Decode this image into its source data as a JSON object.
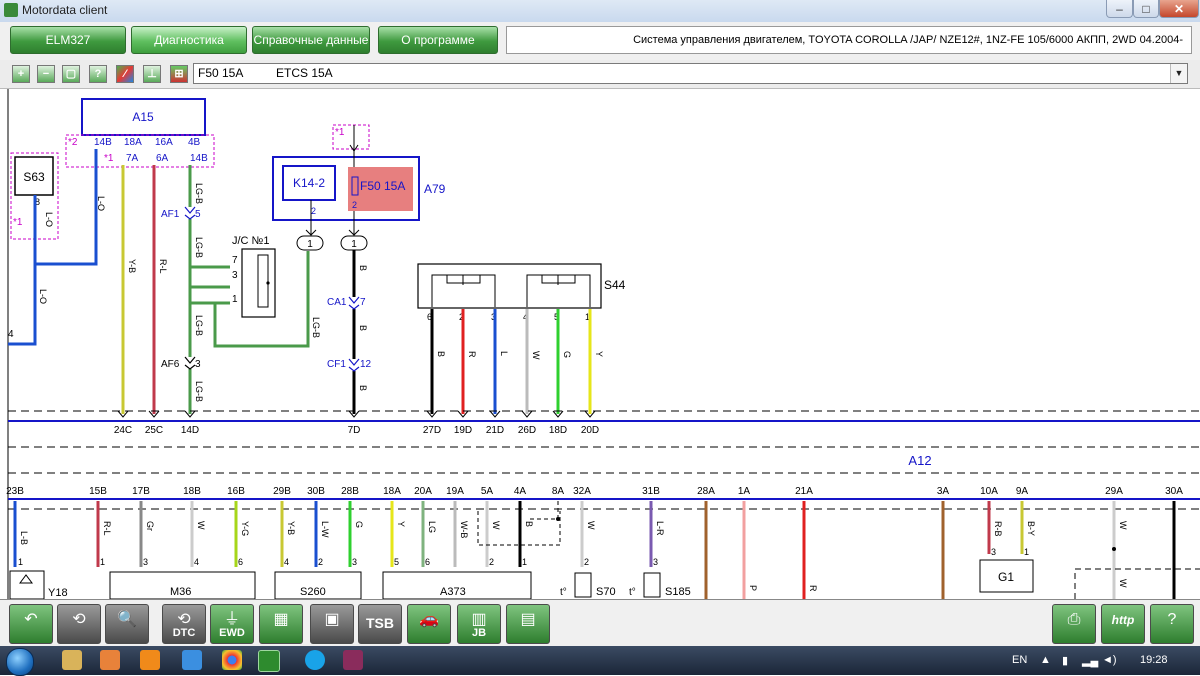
{
  "window": {
    "title": "Motordata client",
    "minimize": "‒",
    "maximize": "□",
    "close": "✕"
  },
  "menu": {
    "buttons": [
      "ELM327",
      "Диагностика",
      "Справочные данные",
      "О программе"
    ],
    "active_index": 1,
    "system_info": "Система управления двигателем, TOYOTA  COROLLA /JAP/  NZE12#,   1NZ-FE  105/6000  АКПП, 2WD  04.2004-"
  },
  "toolbar": {
    "icons": [
      "zoom-in-icon",
      "zoom-out-icon",
      "fit-icon",
      "help-icon",
      "color-icon",
      "ground-icon",
      "terminal-icon"
    ],
    "glyphs": [
      "+",
      "−",
      "▢",
      "?",
      "⁄",
      "⊥",
      "⊞"
    ],
    "selected_fuse": "F50 15A",
    "selected_fuse_desc": "ETCS 15A"
  },
  "diagram": {
    "top": {
      "A15": "A15",
      "A15_pins_top": [
        "*2",
        "14B",
        "18A",
        "16A",
        "4B"
      ],
      "A15_pins_bottom": [
        "*1",
        "7A",
        "6A",
        "14B"
      ],
      "S63": "S63",
      "star1": "*1",
      "star1b": "*1",
      "A79": "A79",
      "K14": "K14-2",
      "K14_pin": "2",
      "F50": "F50 15A",
      "F50_pin": "2",
      "jc": "J/C №1",
      "jc_pins": [
        "7",
        "3",
        "1"
      ],
      "splice_labels": [
        "1",
        "1"
      ],
      "AF1": "AF1",
      "AF1_pin": "5",
      "AF6": "AF6",
      "AF6_pin": "3",
      "CA1": "CA1",
      "CA1_pin": "7",
      "CF1": "CF1",
      "CF1_pin": "12",
      "S44": "S44",
      "S44_pins": [
        "6",
        "2",
        "3",
        "4",
        "5",
        "1"
      ],
      "S63_pin": "8",
      "left_pin": "4",
      "wire_colors": {
        "LO": "L-O",
        "YB": "Y-B",
        "RL": "R-L",
        "LGB": "LG-B",
        "B": "B",
        "R": "R",
        "L": "L",
        "W": "W",
        "G": "G",
        "Y": "Y"
      },
      "bus_labels": [
        "24C",
        "25C",
        "14D",
        "7D",
        "27D",
        "19D",
        "21D",
        "26D",
        "18D",
        "20D"
      ],
      "A12": "A12"
    },
    "bottom": {
      "pins_top": [
        "23B",
        "15B",
        "17B",
        "18B",
        "16B",
        "29B",
        "30B",
        "28B",
        "18A",
        "20A",
        "19A",
        "5A",
        "4A",
        "8A",
        "32A",
        "31B",
        "28A",
        "1A",
        "21A",
        "3A",
        "10A",
        "9A",
        "29A",
        "30A"
      ],
      "wire_colors": [
        "L-B",
        "R-L",
        "Gr",
        "W",
        "Y-G",
        "Y-B",
        "L-W",
        "G",
        "Y",
        "LG",
        "W-B",
        "W",
        "B",
        "W",
        "L-R",
        "R-B",
        "B-Y",
        "W",
        "W",
        "P",
        "R"
      ],
      "component_pins": [
        "1",
        "3",
        "4",
        "6",
        "4",
        "2",
        "3",
        "5",
        "6",
        "2",
        "1",
        "2",
        "3",
        "1",
        "1",
        "3",
        "1"
      ],
      "components": [
        "Y18",
        "M36",
        "S260",
        "A373",
        "S70",
        "S185",
        "G1"
      ],
      "temp_sym": [
        "t°",
        "t°"
      ]
    }
  },
  "bottom_toolbar": {
    "buttons": [
      {
        "name": "back-button",
        "label": "",
        "glyph": "↶"
      },
      {
        "name": "disconnect-button",
        "label": "",
        "glyph": "⟲"
      },
      {
        "name": "search-button",
        "label": "",
        "glyph": "🔍"
      },
      {
        "name": "dtc-button",
        "label": "DTC",
        "glyph": "⟲"
      },
      {
        "name": "ewd-button",
        "label": "EWD",
        "glyph": "⏚"
      },
      {
        "name": "connectors-button",
        "label": "",
        "glyph": "▦"
      },
      {
        "name": "multimeter-button",
        "label": "",
        "glyph": "▣"
      },
      {
        "name": "tsb-button",
        "label": "TSB",
        "glyph": ""
      },
      {
        "name": "car-location-button",
        "label": "",
        "glyph": "🚗"
      },
      {
        "name": "junction-block-button",
        "label": "JB",
        "glyph": "▥"
      },
      {
        "name": "relay-button",
        "label": "",
        "glyph": "▤"
      }
    ],
    "right": [
      {
        "name": "print-button",
        "glyph": "⎙"
      },
      {
        "name": "web-button",
        "glyph": "http"
      },
      {
        "name": "manual-button",
        "glyph": "?"
      }
    ]
  },
  "taskbar": {
    "language": "EN",
    "time": "19:28",
    "apps": [
      "file-explorer",
      "media-player",
      "vlc",
      "internet-explorer",
      "chrome",
      "motordata-client",
      "skype",
      "winrar"
    ]
  }
}
